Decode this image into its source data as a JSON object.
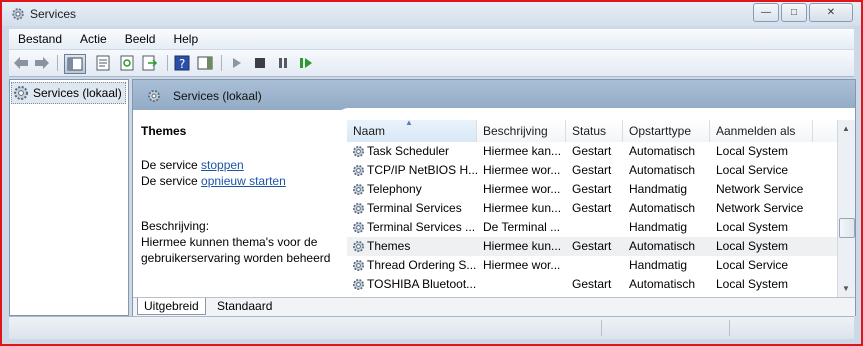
{
  "window": {
    "title": "Services"
  },
  "menu": [
    "Bestand",
    "Actie",
    "Beeld",
    "Help"
  ],
  "tree": {
    "item_label": "Services (lokaal)"
  },
  "pane": {
    "header": "Services (lokaal)",
    "selected_service": "Themes",
    "action_stop_prefix": "De service ",
    "action_stop_link": "stoppen",
    "action_restart_prefix": "De service ",
    "action_restart_link": "opnieuw starten",
    "description_label": "Beschrijving:",
    "description_line1": "Hiermee kunnen thema's voor de",
    "description_line2": "gebruikerservaring worden beheerd"
  },
  "table": {
    "columns": [
      "Naam",
      "Beschrijving",
      "Status",
      "Opstarttype",
      "Aanmelden als"
    ],
    "rows": [
      {
        "name": "Task Scheduler",
        "desc": "Hiermee kan...",
        "status": "Gestart",
        "startup": "Automatisch",
        "logon": "Local System"
      },
      {
        "name": "TCP/IP NetBIOS H...",
        "desc": "Hiermee wor...",
        "status": "Gestart",
        "startup": "Automatisch",
        "logon": "Local Service"
      },
      {
        "name": "Telephony",
        "desc": "Hiermee wor...",
        "status": "Gestart",
        "startup": "Handmatig",
        "logon": "Network Service"
      },
      {
        "name": "Terminal Services",
        "desc": "Hiermee kun...",
        "status": "Gestart",
        "startup": "Automatisch",
        "logon": "Network Service"
      },
      {
        "name": "Terminal Services ...",
        "desc": "De Terminal ...",
        "status": "",
        "startup": "Handmatig",
        "logon": "Local System"
      },
      {
        "name": "Themes",
        "desc": "Hiermee kun...",
        "status": "Gestart",
        "startup": "Automatisch",
        "logon": "Local System"
      },
      {
        "name": "Thread Ordering S...",
        "desc": "Hiermee wor...",
        "status": "",
        "startup": "Handmatig",
        "logon": "Local Service"
      },
      {
        "name": "TOSHIBA Bluetoot...",
        "desc": "",
        "status": "Gestart",
        "startup": "Automatisch",
        "logon": "Local System"
      }
    ]
  },
  "tabs": {
    "extended": "Uitgebreid",
    "standard": "Standaard"
  },
  "colors": {
    "frame": "#e0141a",
    "header_band": "#9fb6cf",
    "link": "#1a56a8"
  },
  "icons": [
    "gear-icon",
    "back-arrow-icon",
    "forward-arrow-icon",
    "play-icon",
    "stop-icon",
    "pause-icon",
    "restart-icon",
    "help-icon"
  ]
}
